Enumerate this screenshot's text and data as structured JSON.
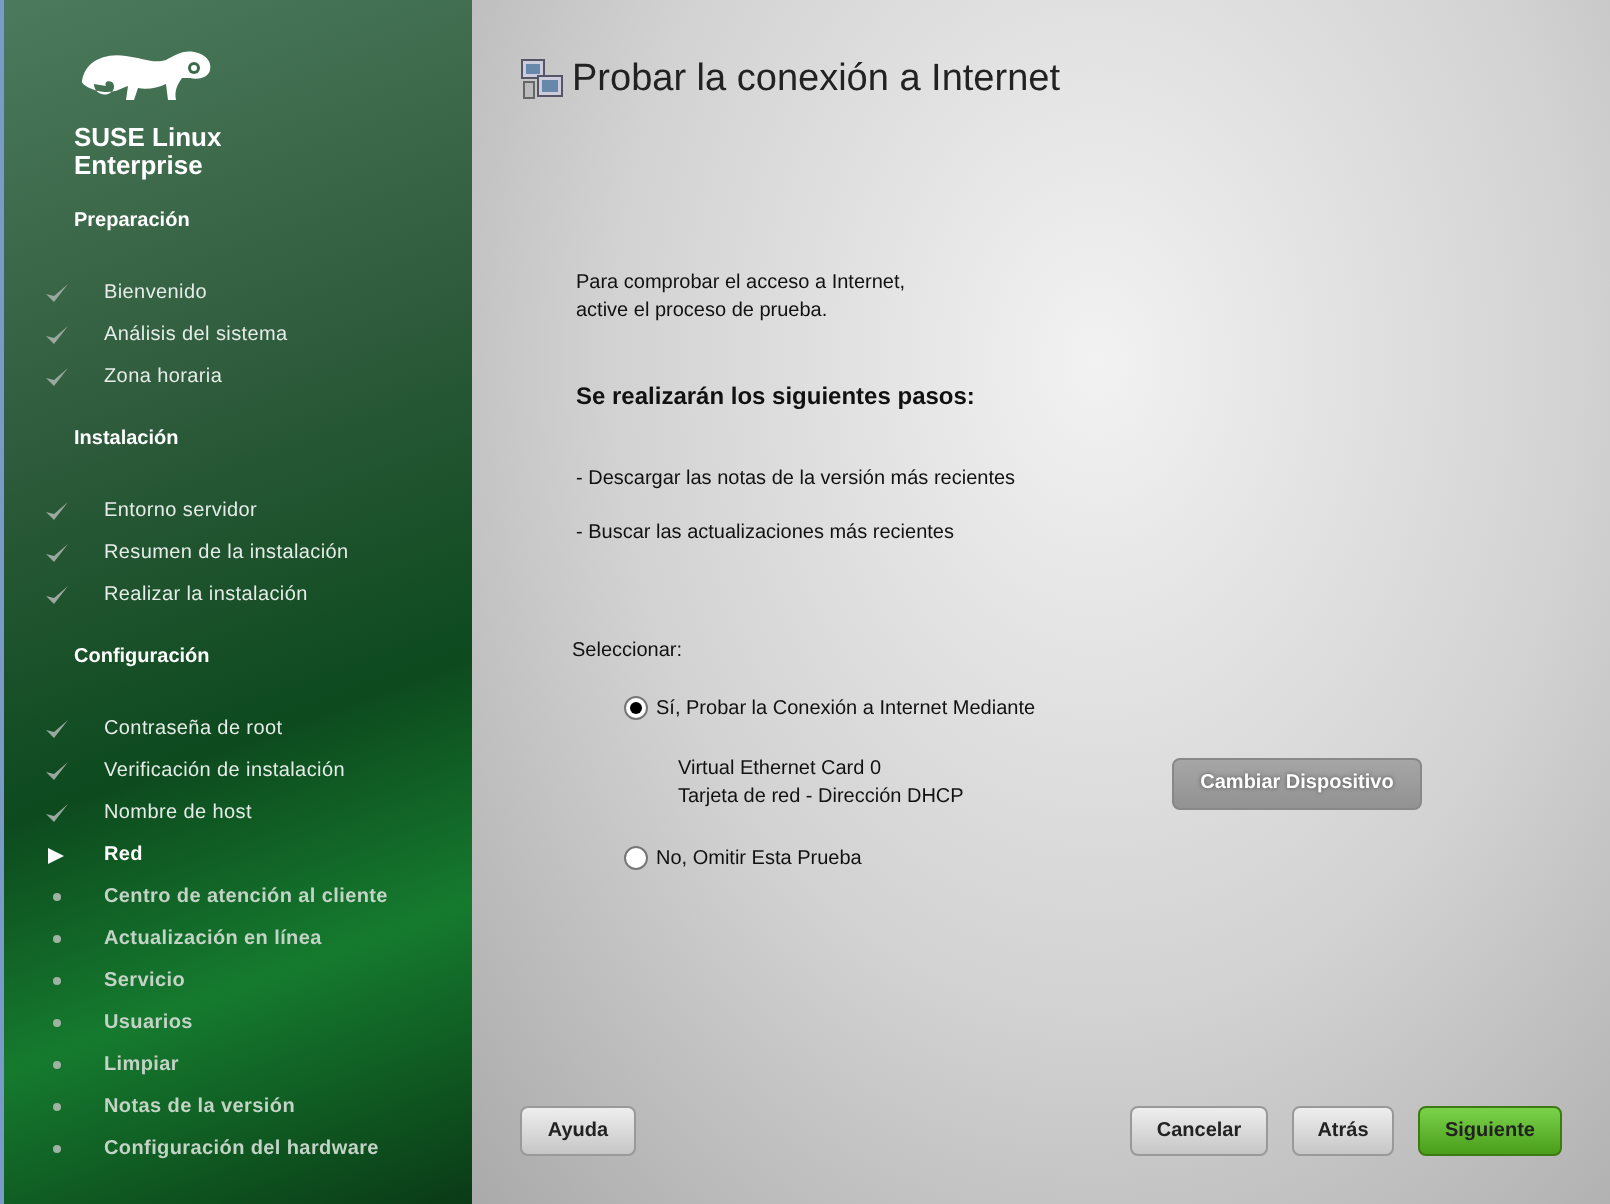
{
  "sidebar": {
    "logo_text": [
      "SUSE",
      "Linux",
      "Enterprise"
    ],
    "sections": [
      {
        "heading": "Preparación",
        "items": [
          {
            "label": "Bienvenido",
            "kind": "done"
          },
          {
            "label": "Análisis del sistema",
            "kind": "done"
          },
          {
            "label": "Zona horaria",
            "kind": "done"
          }
        ]
      },
      {
        "heading": "Instalación",
        "items": [
          {
            "label": "Entorno servidor",
            "kind": "done"
          },
          {
            "label": "Resumen de la instalación",
            "kind": "done"
          },
          {
            "label": "Realizar la instalación",
            "kind": "done"
          }
        ]
      },
      {
        "heading": "Configuración",
        "items": [
          {
            "label": "Contraseña de root",
            "kind": "done"
          },
          {
            "label": "Verificación de instalación",
            "kind": "done"
          },
          {
            "label": "Nombre de host",
            "kind": "done"
          },
          {
            "label": "Red",
            "kind": "current"
          },
          {
            "label": "Centro de atención al cliente",
            "kind": "pending"
          },
          {
            "label": "Actualización en línea",
            "kind": "pending"
          },
          {
            "label": "Servicio",
            "kind": "pending"
          },
          {
            "label": "Usuarios",
            "kind": "pending"
          },
          {
            "label": "Limpiar",
            "kind": "pending"
          },
          {
            "label": "Notas de la versión",
            "kind": "pending"
          },
          {
            "label": "Configuración del hardware",
            "kind": "pending"
          }
        ]
      }
    ]
  },
  "title": "Probar la conexión a Internet",
  "intro": [
    "Para comprobar el acceso a Internet,",
    "active el proceso de prueba."
  ],
  "steps_heading": "Se realizarán los siguientes pasos:",
  "steps": [
    "- Descargar las notas de la versión más recientes",
    "- Buscar las actualizaciones más recientes"
  ],
  "select_label": "Seleccionar:",
  "options": [
    {
      "label": "Sí, Probar la Conexión a Internet Mediante",
      "selected": true
    },
    {
      "label": "No, Omitir Esta Prueba",
      "selected": false
    }
  ],
  "device": {
    "name": "Virtual Ethernet Card 0",
    "detail": "Tarjeta de red - Dirección DHCP",
    "button": "Cambiar Dispositivo"
  },
  "buttons": [
    {
      "label": "Ayuda",
      "kind": "left"
    },
    {
      "label": "Cancelar",
      "kind": "normal"
    },
    {
      "label": "Atrás",
      "kind": "normal"
    },
    {
      "label": "Siguiente",
      "kind": "primary"
    }
  ]
}
